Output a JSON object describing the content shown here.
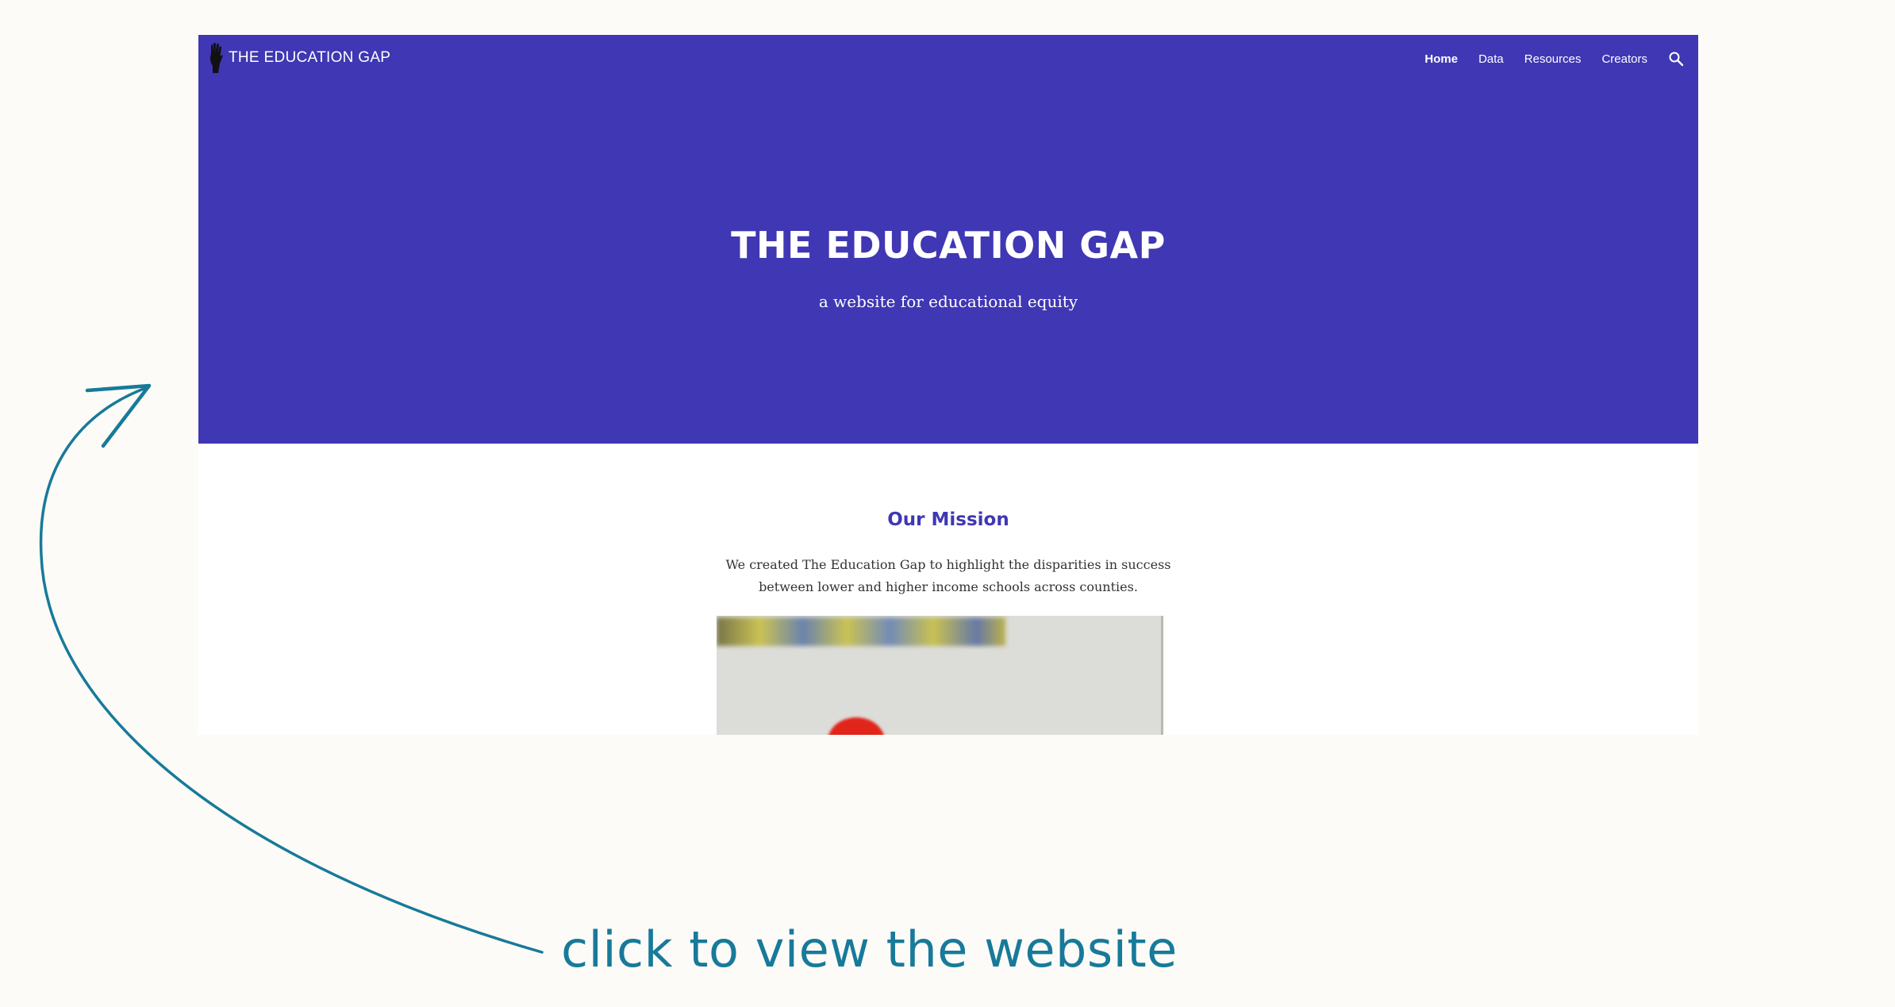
{
  "site": {
    "brand": "THE EDUCATION GAP",
    "nav": [
      {
        "label": "Home",
        "active": true
      },
      {
        "label": "Data",
        "active": false
      },
      {
        "label": "Resources",
        "active": false
      },
      {
        "label": "Creators",
        "active": false
      }
    ],
    "search_icon": "search-icon",
    "hero": {
      "title": "THE EDUCATION GAP",
      "subtitle": "a website for educational equity",
      "background_color": "#3f37b3"
    },
    "mission": {
      "heading": "Our Mission",
      "body": "We created The Education Gap to highlight the disparities in success between lower and higher income schools across counties."
    }
  },
  "annotation": {
    "cta_text": "click to view the website",
    "color": "#177a9a"
  }
}
